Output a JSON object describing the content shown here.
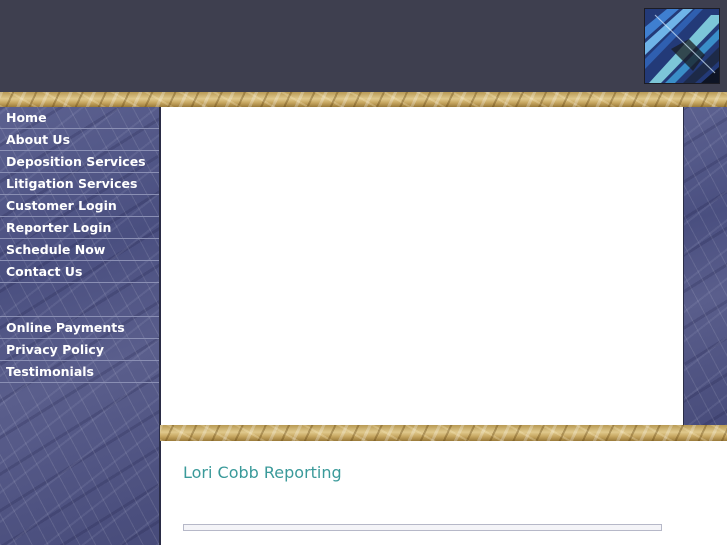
{
  "header": {
    "logo_icon": "blue-pens-photo"
  },
  "nav": {
    "items": [
      {
        "label": "Home"
      },
      {
        "label": "About Us"
      },
      {
        "label": "Deposition Services"
      },
      {
        "label": "Litigation Services"
      },
      {
        "label": "Customer Login"
      },
      {
        "label": "Reporter Login"
      },
      {
        "label": "Schedule Now"
      },
      {
        "label": "Contact Us"
      }
    ],
    "secondary_items": [
      {
        "label": "Online Payments"
      },
      {
        "label": "Privacy Policy"
      },
      {
        "label": "Testimonials"
      }
    ]
  },
  "main": {
    "title": "Lori Cobb Reporting"
  },
  "colors": {
    "header_bg": "#3e3f4f",
    "title_color": "#3a9a9a",
    "marble_blue": "#4a4f80",
    "gold": "#c8a862"
  }
}
